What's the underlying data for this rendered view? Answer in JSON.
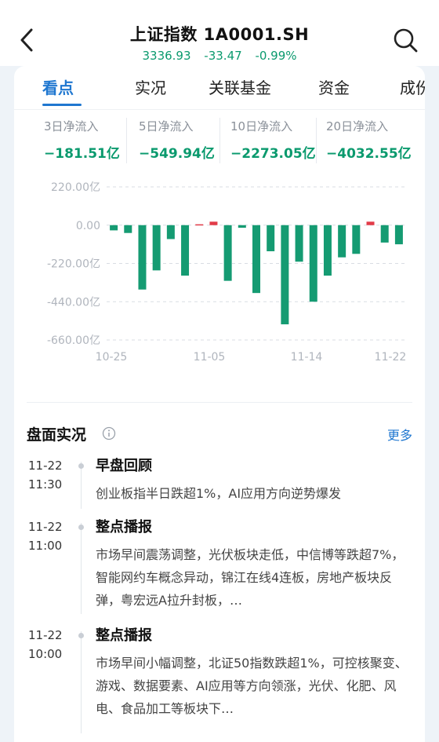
{
  "header": {
    "title": "上证指数 1A0001.SH",
    "price": "3336.93",
    "change": "-33.47",
    "change_pct": "-0.99%",
    "back_icon": "chevron-left-icon",
    "search_icon": "search-icon"
  },
  "tabs": [
    {
      "label": "看点",
      "active": true
    },
    {
      "label": "实况",
      "active": false
    },
    {
      "label": "关联基金",
      "active": false
    },
    {
      "label": "资金",
      "active": false
    },
    {
      "label": "成份",
      "active": false
    }
  ],
  "flows": [
    {
      "label": "3日净流入",
      "value": "−181.51亿"
    },
    {
      "label": "5日净流入",
      "value": "−549.94亿"
    },
    {
      "label": "10日净流入",
      "value": "−2273.05亿"
    },
    {
      "label": "20日净流入",
      "value": "−4032.55亿"
    }
  ],
  "chart_data": {
    "type": "bar",
    "title": "",
    "xlabel": "",
    "ylabel": "",
    "ylim": [
      -660,
      220
    ],
    "y_ticks": [
      220,
      0,
      -220,
      -440,
      -660
    ],
    "y_tick_labels": [
      "220.00亿",
      "0.00",
      "-220.00亿",
      "-440.00亿",
      "-660.00亿"
    ],
    "x_tick_labels": [
      "10-25",
      "11-05",
      "11-14",
      "11-22"
    ],
    "grid": true,
    "colors": {
      "positive": "#e23b48",
      "negative": "#159b72"
    },
    "values": [
      -30,
      -45,
      -370,
      -260,
      -80,
      -290,
      5,
      20,
      -320,
      -15,
      -390,
      -150,
      -570,
      -210,
      -440,
      -290,
      -185,
      -165,
      20,
      -100,
      -110
    ]
  },
  "section": {
    "title": "盘面实况",
    "more_label": "更多",
    "info_icon": "info-icon"
  },
  "timeline": [
    {
      "date": "11-22",
      "time": "11:30",
      "headline": "早盘回顾",
      "body": "创业板指半日跌超1%，AI应用方向逆势爆发"
    },
    {
      "date": "11-22",
      "time": "11:00",
      "headline": "整点播报",
      "body": "市场早间震荡调整，光伏板块走低，中信博等跌超7%，智能网约车概念异动，锦江在线4连板，房地产板块反弹，粤宏远A拉升封板，…"
    },
    {
      "date": "11-22",
      "time": "10:00",
      "headline": "整点播报",
      "body": "市场早间小幅调整，北证50指数跌超1%，可控核聚变、游戏、数据要素、AI应用等方向领涨，光伏、化肥、风电、食品加工等板块下…"
    }
  ]
}
